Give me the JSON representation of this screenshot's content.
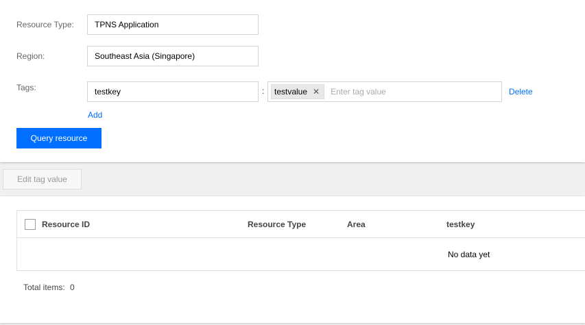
{
  "form": {
    "resource_type_label": "Resource Type:",
    "resource_type_value": "TPNS Application",
    "region_label": "Region:",
    "region_value": "Southeast Asia (Singapore)",
    "tags_label": "Tags:",
    "tag_key": "testkey",
    "tag_colon": ":",
    "tag_value_chip": "testvalue",
    "tag_value_placeholder": "Enter tag value",
    "delete_label": "Delete",
    "add_label": "Add",
    "query_button": "Query resource"
  },
  "toolbar": {
    "edit_tag_button": "Edit tag value"
  },
  "table": {
    "columns": [
      "Resource ID",
      "Resource Type",
      "Area",
      "testkey"
    ],
    "empty_text": "No data yet",
    "total_label": "Total items:",
    "total_count": "0"
  },
  "colors": {
    "primary": "#006eff",
    "link": "#006eff"
  },
  "icons": {
    "chip_close": "close-icon"
  }
}
